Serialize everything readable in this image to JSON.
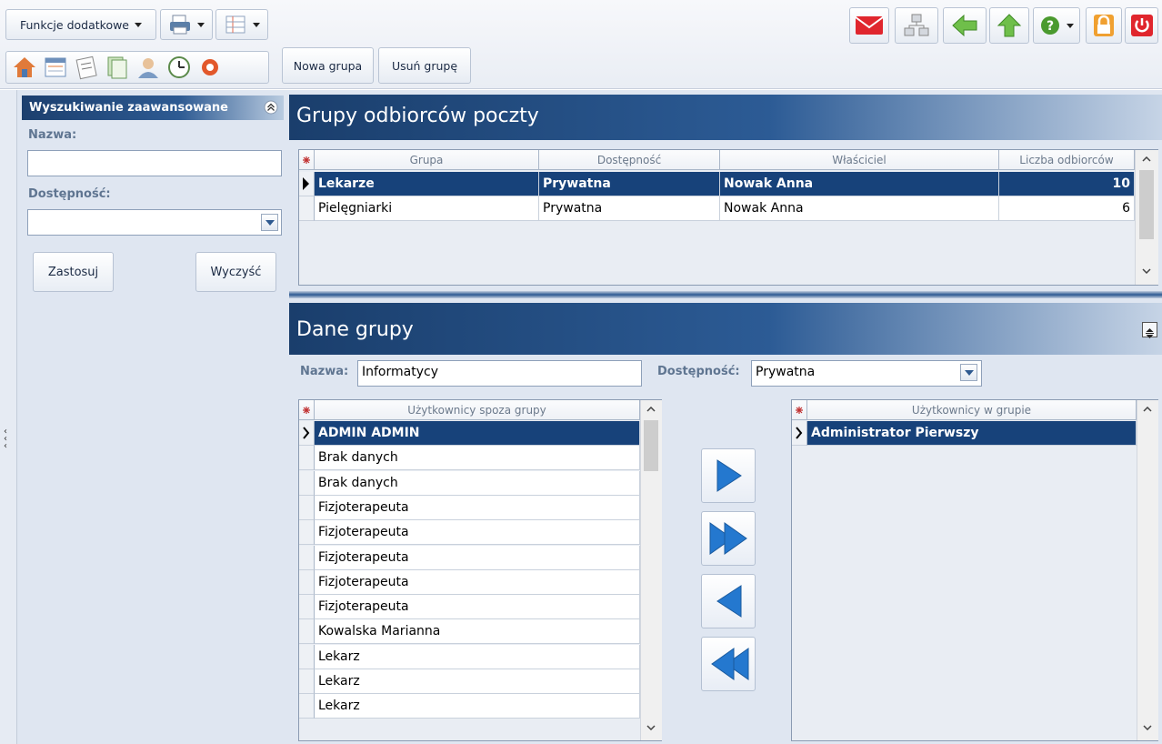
{
  "toolbar": {
    "extra_functions_label": "Funkcje dodatkowe",
    "new_group_label": "Nowa grupa",
    "delete_group_label": "Usuń grupę"
  },
  "search": {
    "title": "Wyszukiwanie zaawansowane",
    "name_label": "Nazwa:",
    "name_value": "",
    "availability_label": "Dostępność:",
    "availability_value": "",
    "apply_label": "Zastosuj",
    "clear_label": "Wyczyść"
  },
  "groups": {
    "title": "Grupy odbiorców poczty",
    "columns": [
      "Grupa",
      "Dostępność",
      "Właściciel",
      "Liczba odbiorców"
    ],
    "rows": [
      {
        "group": "Lekarze",
        "availability": "Prywatna",
        "owner": "Nowak Anna",
        "count": "10",
        "selected": true
      },
      {
        "group": "Pielęgniarki",
        "availability": "Prywatna",
        "owner": "Nowak Anna",
        "count": "6",
        "selected": false
      }
    ]
  },
  "details": {
    "title": "Dane grupy",
    "name_label": "Nazwa:",
    "name_value": "Informatycy",
    "availability_label": "Dostępność:",
    "availability_value": "Prywatna",
    "outside_header": "Użytkownicy spoza grupy",
    "outside_users": [
      "ADMIN ADMIN",
      "Brak danych",
      "Brak danych",
      "Fizjoterapeuta",
      "Fizjoterapeuta",
      "Fizjoterapeuta",
      "Fizjoterapeuta",
      "Fizjoterapeuta",
      "Kowalska Marianna",
      "Lekarz",
      "Lekarz",
      "Lekarz"
    ],
    "inside_header": "Użytkownicy w grupie",
    "inside_users": [
      "Administrator Pierwszy"
    ]
  },
  "colors": {
    "header_dark": "#1a3e6c",
    "selection": "#17427a",
    "arrow_blue": "#1f73c8"
  }
}
